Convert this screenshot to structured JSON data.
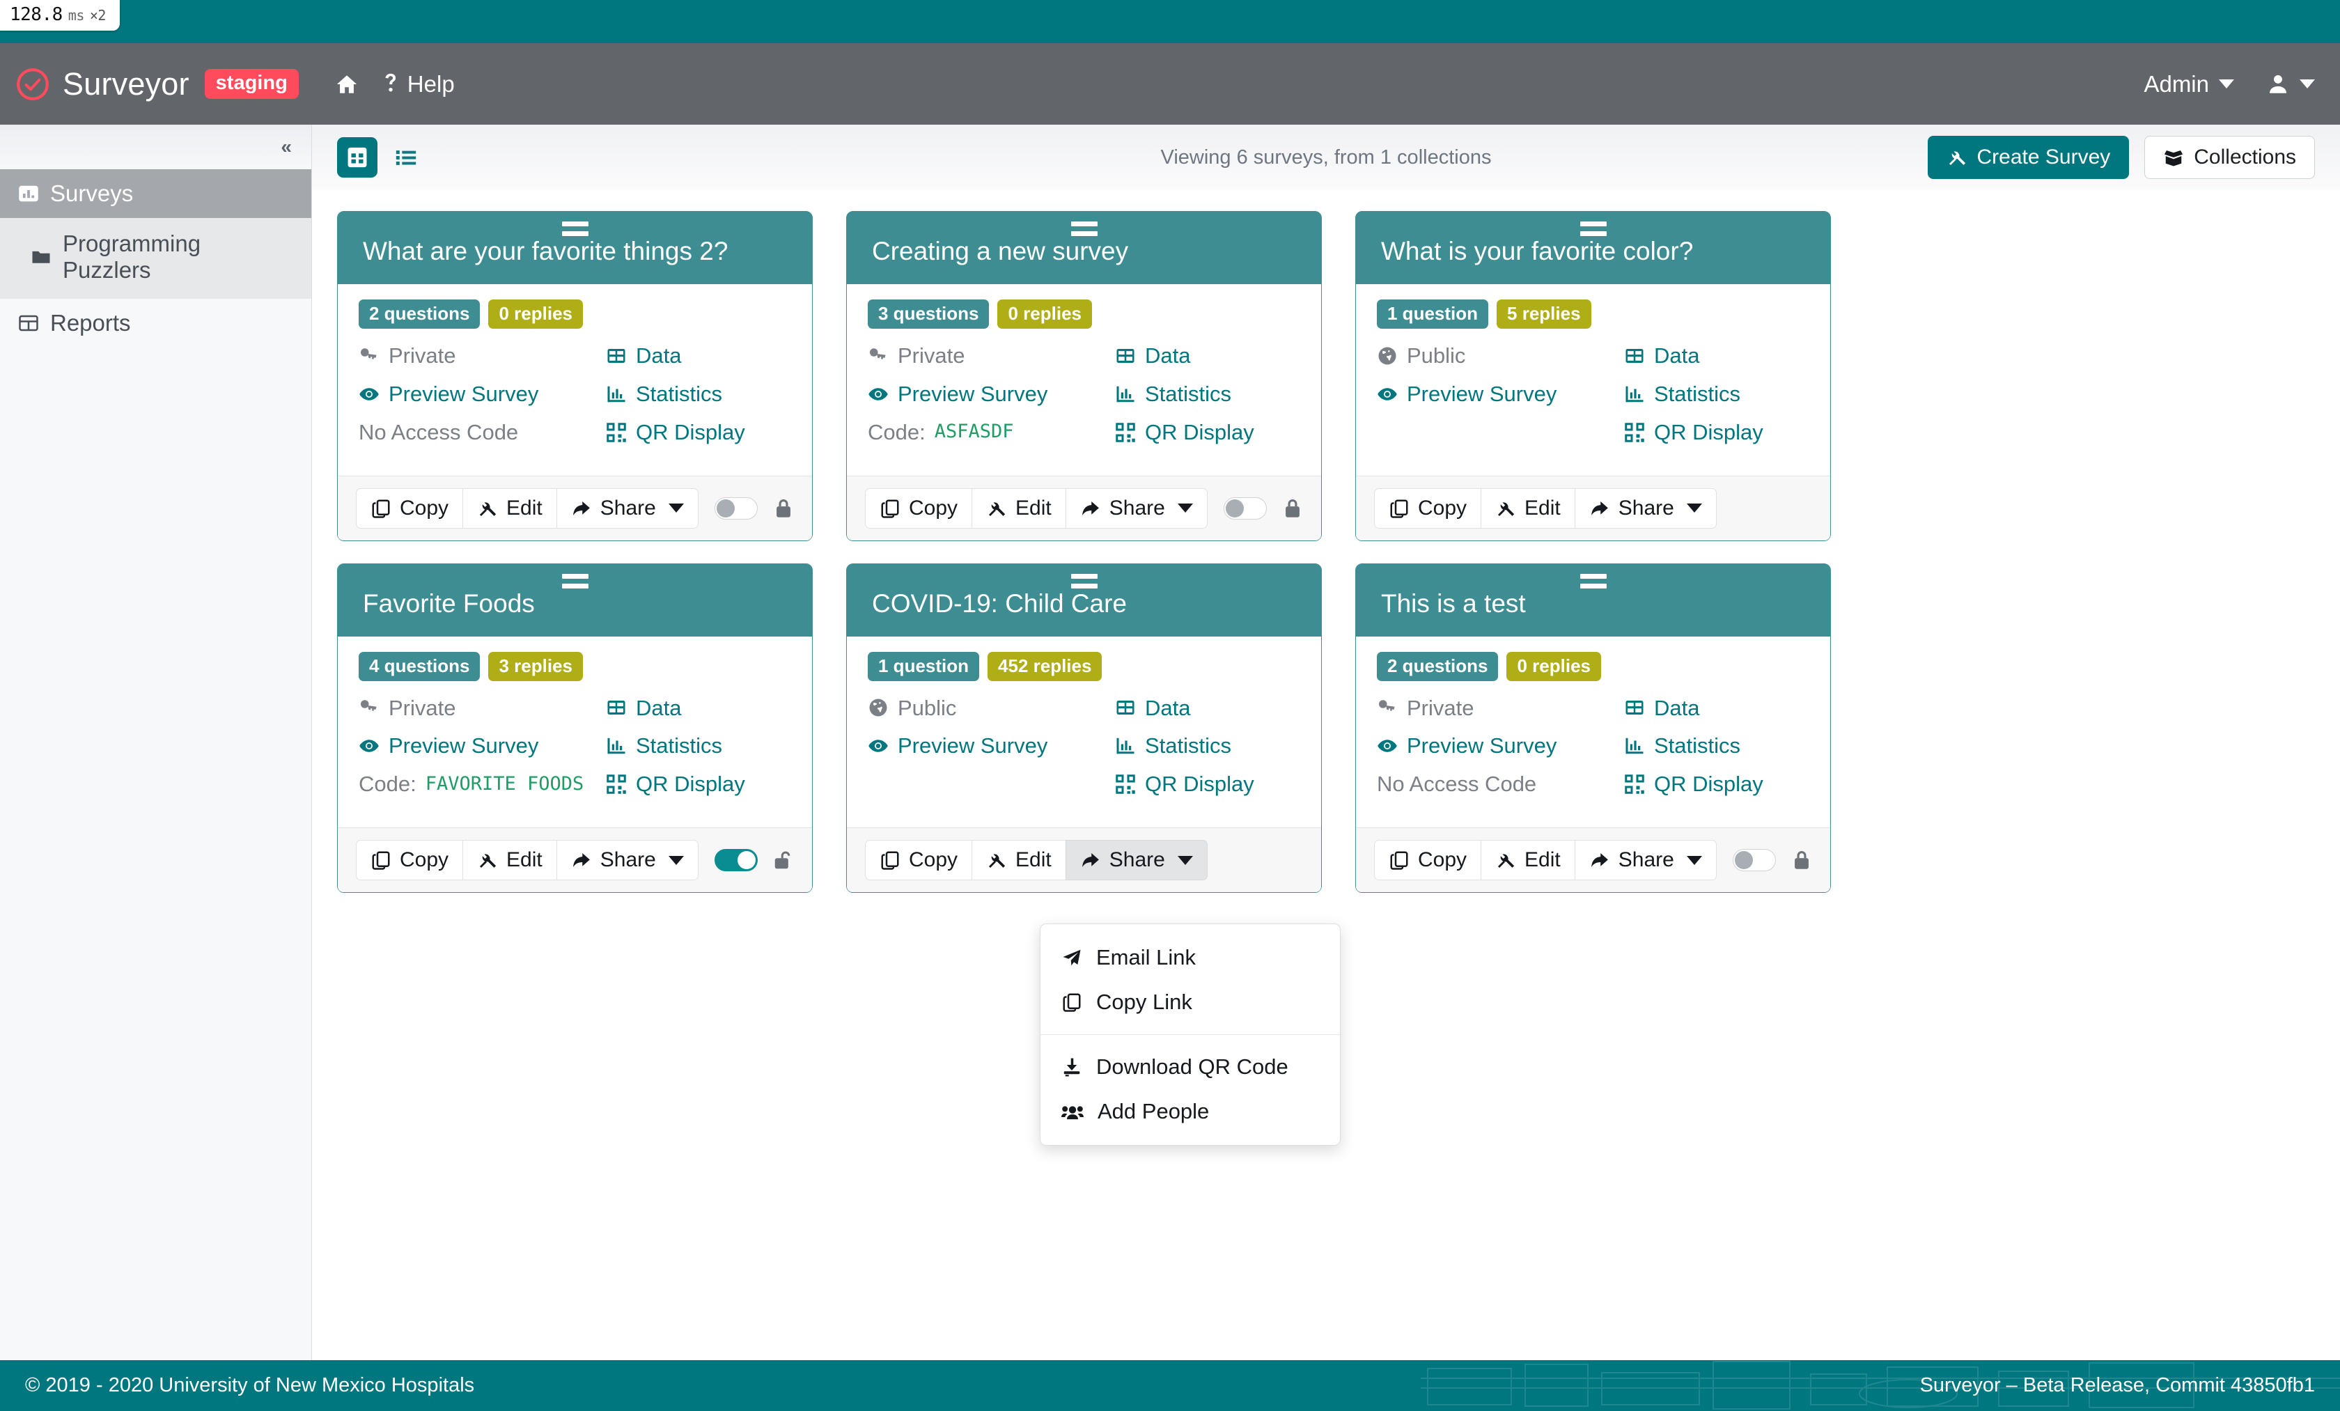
{
  "perf_overlay": {
    "value": "128.8",
    "unit": "ms",
    "multiplier": "×2"
  },
  "navbar": {
    "brand": "Surveyor",
    "env_badge": "staging",
    "home_label": "",
    "help_label": "Help",
    "admin_label": "Admin",
    "logo_color": "#ff4b5c",
    "bar_color": "#626569"
  },
  "sidebar": {
    "collapse_label": "«",
    "items": [
      {
        "label": "Surveys",
        "icon": "bar-chart-icon",
        "active": true
      },
      {
        "label": "Programming Puzzlers",
        "icon": "folder-icon",
        "active": false
      },
      {
        "label": "Reports",
        "icon": "table-icon",
        "active": false
      }
    ]
  },
  "toolbar": {
    "grid_view_icon": "grid-view-icon",
    "list_view_icon": "list-view-icon",
    "status": "Viewing 6 surveys, from 1 collections",
    "create_survey_label": "Create Survey",
    "collections_label": "Collections",
    "primary_color": "#00767f"
  },
  "card_labels": {
    "data": "Data",
    "statistics": "Statistics",
    "qr_display": "QR Display",
    "preview": "Preview Survey",
    "copy": "Copy",
    "edit": "Edit",
    "share": "Share",
    "code_prefix": "Code:",
    "no_code": "No Access Code",
    "header_color": "#3e8d92",
    "replies_color": "#b0ae16",
    "code_color": "#1f9d65"
  },
  "surveys": [
    {
      "title": "What are your favorite things 2?",
      "questions": "2 questions",
      "replies": "0 replies",
      "visibility": "Private",
      "visibility_icon": "key-icon",
      "access_code": null,
      "access_code_text": "No Access Code",
      "toggle_on": false,
      "lock_icon": "lock-closed-icon",
      "has_toggle": true,
      "share_open": false
    },
    {
      "title": "Creating a new survey",
      "questions": "3 questions",
      "replies": "0 replies",
      "visibility": "Private",
      "visibility_icon": "key-icon",
      "access_code": "ASFASDF",
      "access_code_text": null,
      "toggle_on": false,
      "lock_icon": "lock-closed-icon",
      "has_toggle": true,
      "share_open": false
    },
    {
      "title": "What is your favorite color?",
      "questions": "1 question",
      "replies": "5 replies",
      "visibility": "Public",
      "visibility_icon": "globe-icon",
      "access_code": null,
      "access_code_text": null,
      "toggle_on": false,
      "lock_icon": null,
      "has_toggle": false,
      "share_open": false
    },
    {
      "title": "Favorite Foods",
      "questions": "4 questions",
      "replies": "3 replies",
      "visibility": "Private",
      "visibility_icon": "key-icon",
      "access_code": "FAVORITE FOODS",
      "access_code_text": null,
      "toggle_on": true,
      "lock_icon": "lock-open-icon",
      "has_toggle": true,
      "share_open": false
    },
    {
      "title": "COVID-19: Child Care",
      "questions": "1 question",
      "replies": "452 replies",
      "visibility": "Public",
      "visibility_icon": "globe-icon",
      "access_code": null,
      "access_code_text": null,
      "toggle_on": false,
      "lock_icon": null,
      "has_toggle": false,
      "share_open": true
    },
    {
      "title": "This is a test",
      "questions": "2 questions",
      "replies": "0 replies",
      "visibility": "Private",
      "visibility_icon": "key-icon",
      "access_code": null,
      "access_code_text": "No Access Code",
      "toggle_on": false,
      "lock_icon": "lock-closed-icon",
      "has_toggle": true,
      "share_open": false
    }
  ],
  "share_menu": {
    "items": [
      {
        "label": "Email Link",
        "icon": "paper-plane-icon"
      },
      {
        "label": "Copy Link",
        "icon": "copy-icon"
      },
      {
        "label": "Download QR Code",
        "icon": "download-icon"
      },
      {
        "label": "Add People",
        "icon": "users-icon"
      }
    ],
    "separator_after_index": 1
  },
  "footer": {
    "copyright": "© 2019 - 2020 University of New Mexico Hospitals",
    "release": "Surveyor – Beta Release, Commit 43850fb1",
    "bg_color": "#00767f"
  }
}
